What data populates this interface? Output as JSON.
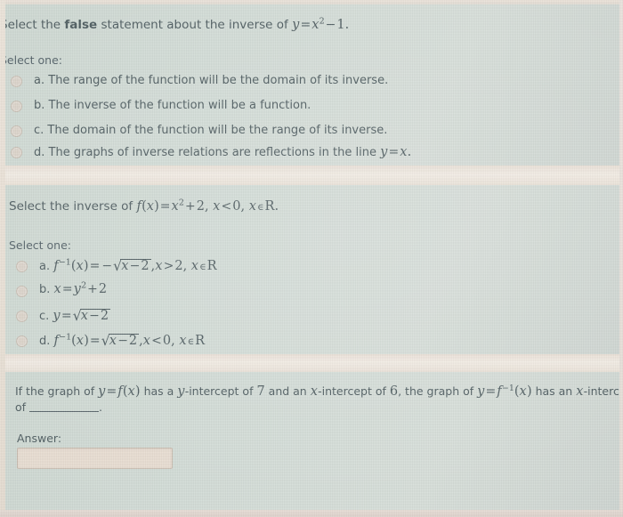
{
  "page": {
    "kind": "online-quiz-questions",
    "background_color": "#d4ddd8",
    "gap_color": "#efe7dd",
    "text_color": "#4f5d61"
  },
  "questions": [
    {
      "id": "q1",
      "stem_prefix": "Select the ",
      "stem_bold": "false",
      "stem_suffix": " statement about the inverse of ",
      "stem_math": "y = x² − 1.",
      "select_one_label": "Select one:",
      "options": [
        {
          "letter": "a.",
          "text": "The range of the function will be the domain of its inverse."
        },
        {
          "letter": "b.",
          "text": "The inverse of the function will be a function."
        },
        {
          "letter": "c.",
          "text": "The domain of the function will be the range of its inverse."
        },
        {
          "letter": "d.",
          "text": "The graphs of inverse relations are reflections in the line y = x."
        }
      ]
    },
    {
      "id": "q2",
      "stem_prefix": "Select the inverse of ",
      "stem_math": "f(x) = x² + 2, x < 0, x ∈ R.",
      "select_one_label": "Select one:",
      "options": [
        {
          "letter": "a.",
          "text": "f⁻¹(x) = −√(x − 2), x > 2, x ∈ R"
        },
        {
          "letter": "b.",
          "text": "x = y² + 2"
        },
        {
          "letter": "c.",
          "text": "y = √(x − 2)"
        },
        {
          "letter": "d.",
          "text": "f⁻¹(x) = √(x − 2), x < 0, x ∈ R"
        }
      ]
    },
    {
      "id": "q3",
      "stem_line1": "If the graph of y = f(x) has a y-intercept of 7 and an x-intercept of 6, the graph of y = f⁻¹(x) has an x-intercept",
      "stem_line2": "of ___________.",
      "y_intercept_value": "7",
      "x_intercept_value": "6",
      "answer_label": "Answer:",
      "answer_value": "",
      "answer_placeholder": ""
    }
  ]
}
